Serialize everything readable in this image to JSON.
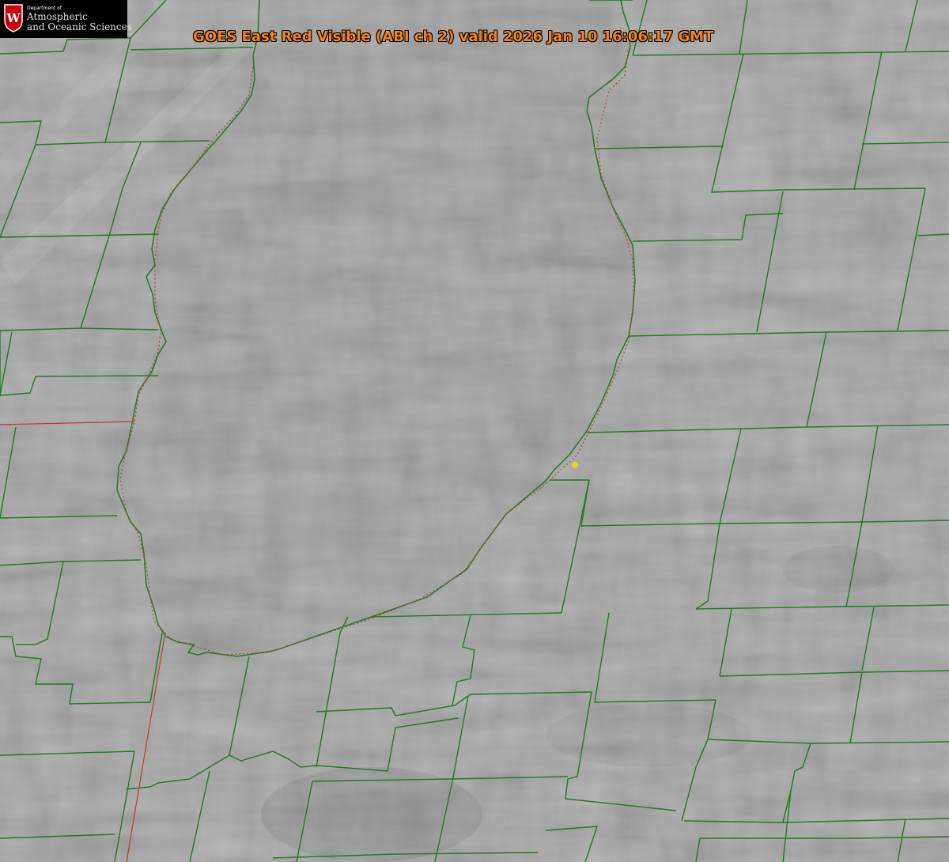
{
  "header": {
    "title": "GOES East Red Visible (ABI ch 2) valid 2026 Jan 10 16:06:17 GMT"
  },
  "logo": {
    "department": "Department of",
    "line1": "Atmospheric",
    "line2": "and Oceanic Sciences",
    "monogram": "W",
    "shield_color": "#c5050c"
  },
  "map": {
    "imagery": "visible-satellite-grayscale",
    "county_line_color": "#1f7a1f",
    "shoreline_color": "#1f7a1f",
    "state_line_color": "#c0392b",
    "station_marker_color": "#e6d22a",
    "lake_color": "#8a8a8a",
    "land_color": "#939393"
  }
}
